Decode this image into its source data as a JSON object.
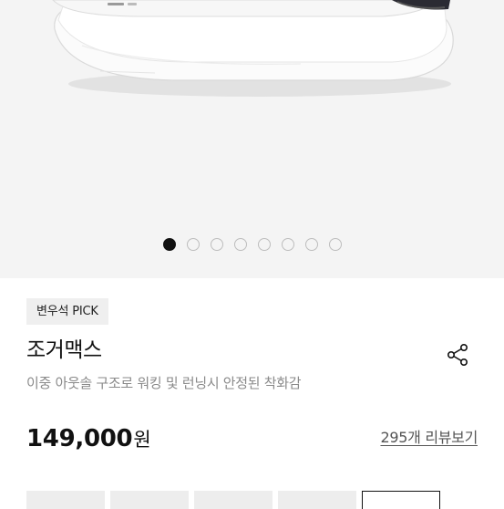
{
  "gallery": {
    "image_alt": "white running shoe",
    "slides": [
      {
        "active": true
      },
      {
        "active": false
      },
      {
        "active": false
      },
      {
        "active": false
      },
      {
        "active": false
      },
      {
        "active": false
      },
      {
        "active": false
      },
      {
        "active": false
      }
    ]
  },
  "product": {
    "badge": "변우석 PICK",
    "name": "조거맥스",
    "description": "이중 아웃솔 구조로 워킹 및 런닝시 안정된 착화감",
    "price": "149,000",
    "price_unit": "원",
    "review_link": "295개 리뷰보기"
  },
  "thumbnails": [
    {
      "selected": false
    },
    {
      "selected": false
    },
    {
      "selected": false
    },
    {
      "selected": false
    },
    {
      "selected": false
    }
  ],
  "icons": {
    "share": "share-icon"
  },
  "colors": {
    "hero_bg": "#f4f4f4",
    "active_dot": "#111111",
    "text_muted": "#8a8a8a"
  }
}
